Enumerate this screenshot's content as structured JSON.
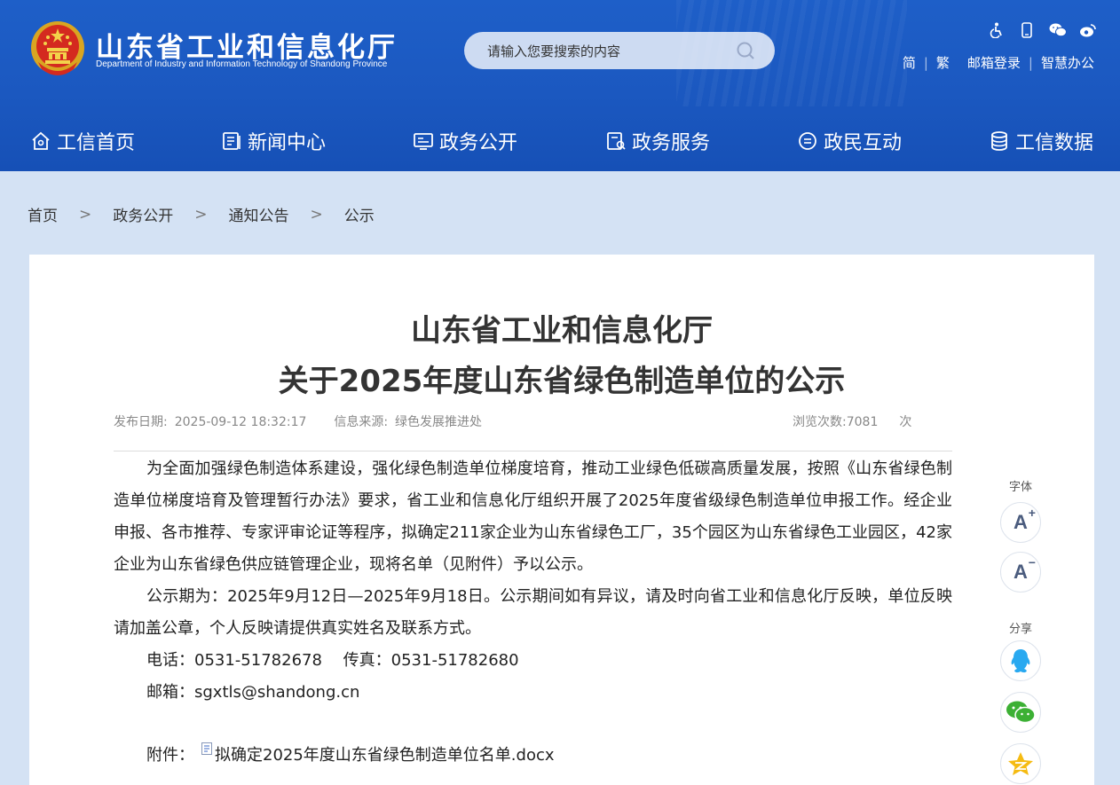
{
  "header": {
    "title": "山东省工业和信息化厅",
    "subtitle": "Department of Industry and Information Technology of Shandong Province",
    "search_placeholder": "请输入您要搜索的内容",
    "icons": [
      "accessibility-icon",
      "mobile-icon",
      "wechat-icon",
      "weibo-icon"
    ],
    "links": {
      "simplified": "简",
      "traditional": "繁",
      "mail_login": "邮箱登录",
      "smart_office": "智慧办公"
    }
  },
  "nav": [
    {
      "label": "工信首页",
      "icon": "home-icon"
    },
    {
      "label": "新闻中心",
      "icon": "news-icon"
    },
    {
      "label": "政务公开",
      "icon": "gov-affairs-icon"
    },
    {
      "label": "政务服务",
      "icon": "service-icon"
    },
    {
      "label": "政民互动",
      "icon": "interaction-icon"
    },
    {
      "label": "工信数据",
      "icon": "database-icon"
    }
  ],
  "breadcrumb": {
    "items": [
      "首页",
      "政务公开",
      "通知公告",
      "公示"
    ],
    "separator": ">"
  },
  "article": {
    "title_line1": "山东省工业和信息化厅",
    "title_line2": "关于2025年度山东省绿色制造单位的公示",
    "publish_label": "发布日期:",
    "publish_date": "2025-09-12 18:32:17",
    "source_label": "信息来源:",
    "source": "绿色发展推进处",
    "views_label": "浏览次数:",
    "views": "7081",
    "views_unit": "次",
    "paragraph1": "为全面加强绿色制造体系建设，强化绿色制造单位梯度培育，推动工业绿色低碳高质量发展，按照《山东省绿色制造单位梯度培育及管理暂行办法》要求，省工业和信息化厅组织开展了2025年度省级绿色制造单位申报工作。经企业申报、各市推荐、专家评审论证等程序，拟确定211家企业为山东省绿色工厂，35个园区为山东省绿色工业园区，42家企业为山东省绿色供应链管理企业，现将名单（见附件）予以公示。",
    "paragraph2": "公示期为：2025年9月12日—2025年9月18日。公示期间如有异议，请及时向省工业和信息化厅反映，单位反映请加盖公章，个人反映请提供真实姓名及联系方式。",
    "phone_line": "电话：0531-51782678　 传真：0531-51782680",
    "email_line": "邮箱：sgxtls@shandong.cn",
    "attachment_label": "附件：",
    "attachment_name": "拟确定2025年度山东省绿色制造单位名单.docx"
  },
  "sidebar": {
    "font_label": "字体",
    "font_increase": "A",
    "font_decrease": "A",
    "share_label": "分享",
    "share_icons": [
      "qq-icon",
      "wechat-share-icon",
      "qzone-icon"
    ]
  },
  "colors": {
    "header_blue": "#1b58c0",
    "page_bg": "#d4e2f4",
    "text": "#333333",
    "meta_gray": "#888888"
  }
}
